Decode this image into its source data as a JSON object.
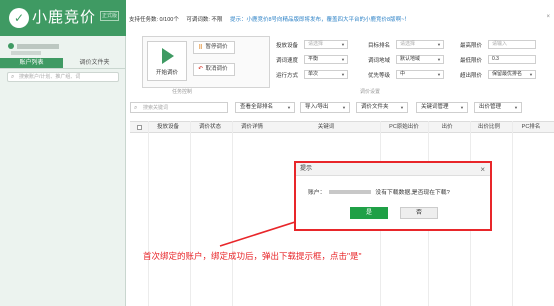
{
  "sidebar": {
    "logo_mark": "✓",
    "logo_text": "小鹿竞价",
    "logo_badge": "正式版",
    "tabs": [
      {
        "label": "账户列表",
        "active": true
      },
      {
        "label": "调价文件夹",
        "active": false
      }
    ],
    "search_placeholder": "搜索账户/计划、推广组、词"
  },
  "top": {
    "task_count_label": "支持任务数: 0/100个",
    "adjust_mode_label": "可调词数: 不限",
    "notice": "提示：小鹿竞价8号向精品版即将发布，覆盖四大平台的小鹿竞价8版啊~！",
    "close_glyph": "×"
  },
  "task_panel": {
    "start_label": "开始调价",
    "pause_label": "暂停调价",
    "cancel_label": "取消调价",
    "caption": "任务控制"
  },
  "settings": {
    "caption": "调价设置",
    "rows": [
      {
        "label": "投放设备",
        "value": "请选择",
        "placeholder": true
      },
      {
        "label": "调词速度",
        "value": "平衡",
        "placeholder": false
      },
      {
        "label": "运行方式",
        "value": "单次",
        "placeholder": false
      },
      {
        "label": "目标排名",
        "value": "请选择",
        "placeholder": true
      },
      {
        "label": "调词地域",
        "value": "默认地域",
        "placeholder": false
      },
      {
        "label": "优先等级",
        "value": "中",
        "placeholder": false
      },
      {
        "label": "最高限价",
        "value": "请输入",
        "placeholder": true
      },
      {
        "label": "最低限价",
        "value": "0.3",
        "placeholder": false
      },
      {
        "label": "超出限价",
        "value": "保留最优排名",
        "placeholder": false
      }
    ]
  },
  "toolbar": {
    "search_placeholder": "搜索关键词",
    "buttons": [
      "查看全部排名",
      "导入/导出",
      "调价文件夹",
      "关键词管理",
      "出价管理"
    ]
  },
  "table": {
    "columns": [
      "投放设备",
      "调价状态",
      "调价详情",
      "关键词",
      "PC原始出价",
      "出价",
      "出价比例",
      "PC排名"
    ]
  },
  "modal": {
    "title": "提示",
    "close_glyph": "×",
    "msg_prefix": "账户：",
    "msg_suffix": "没有下载数据,是否现在下载?",
    "yes_label": "是",
    "no_label": "否"
  },
  "annotation": {
    "text": "首次绑定的账户，绑定成功后，弹出下载提示框，点击\"是\"",
    "color": "#e8262a"
  },
  "icons": {
    "search": "⌕",
    "caret": "▼",
    "pause": "||",
    "cancel": "↶"
  },
  "colors": {
    "brand": "#3f9a63",
    "accent_button": "#1fa046",
    "highlight": "#e8262a"
  }
}
